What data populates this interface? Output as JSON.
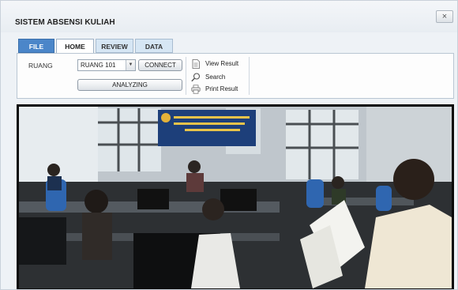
{
  "window": {
    "title": "SISTEM ABSENSI KULIAH",
    "close_glyph": "×"
  },
  "tabs": [
    {
      "label": "FILE"
    },
    {
      "label": "HOME"
    },
    {
      "label": "REVIEW"
    },
    {
      "label": "DATA"
    }
  ],
  "controls": {
    "ruang_label": "RUANG",
    "ruang_value": "RUANG 101",
    "connect_label": "CONNECT",
    "analyze_label": "ANALYZING"
  },
  "actions": {
    "view_result": "View Result",
    "search": "Search",
    "print_result": "Print Result"
  },
  "camera": {
    "description_icons": [
      "document-icon",
      "magnifier-icon",
      "printer-icon"
    ],
    "accent": "#4b86c9"
  }
}
